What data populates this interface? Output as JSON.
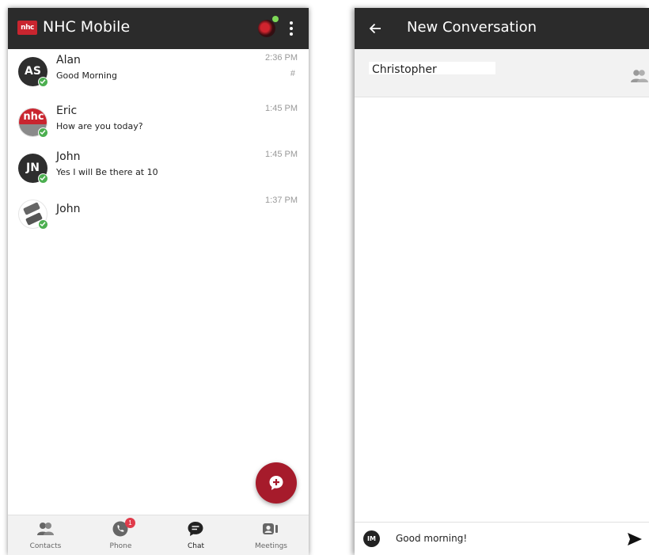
{
  "left_screen": {
    "header": {
      "app_logo": "nhc",
      "title": "NHC Mobile",
      "menu_icon": "kebab-vertical-icon",
      "presence_color": "#7ed957"
    },
    "chats": [
      {
        "name": "Alan",
        "initials": "AS",
        "preview": "Good Morning",
        "time": "2:36 PM",
        "extra": "#",
        "status": "online"
      },
      {
        "name": "Eric",
        "initials": "nhc",
        "preview": "How are you today?",
        "time": "1:45 PM",
        "extra": "",
        "status": "online"
      },
      {
        "name": "John",
        "initials": "JN",
        "preview": "Yes I will Be there at 10",
        "time": "1:45 PM",
        "extra": "",
        "status": "online"
      },
      {
        "name": "John",
        "initials": "",
        "preview": "",
        "time": "1:37 PM",
        "extra": "",
        "status": "online"
      }
    ],
    "fab": {
      "icon": "new-chat-plus-icon",
      "color": "#a61b2b"
    },
    "bottom_nav": [
      {
        "label": "Contacts",
        "icon": "contacts-icon",
        "active": false
      },
      {
        "label": "Phone",
        "icon": "phone-icon",
        "active": false,
        "badge": "1"
      },
      {
        "label": "Chat",
        "icon": "chat-icon",
        "active": true
      },
      {
        "label": "Meetings",
        "icon": "video-camera-icon",
        "active": false
      }
    ]
  },
  "right_screen": {
    "header": {
      "back_icon": "back-arrow-icon",
      "title": "New Conversation"
    },
    "recipient": {
      "value": "Christopher",
      "icon": "group-icon"
    },
    "compose": {
      "avatar_initials": "IM",
      "text": "Good morning!",
      "send_icon": "send-icon"
    }
  },
  "colors": {
    "header_bg": "#2b2b2b",
    "brand_red": "#c9252f",
    "status_green": "#4caf50"
  }
}
